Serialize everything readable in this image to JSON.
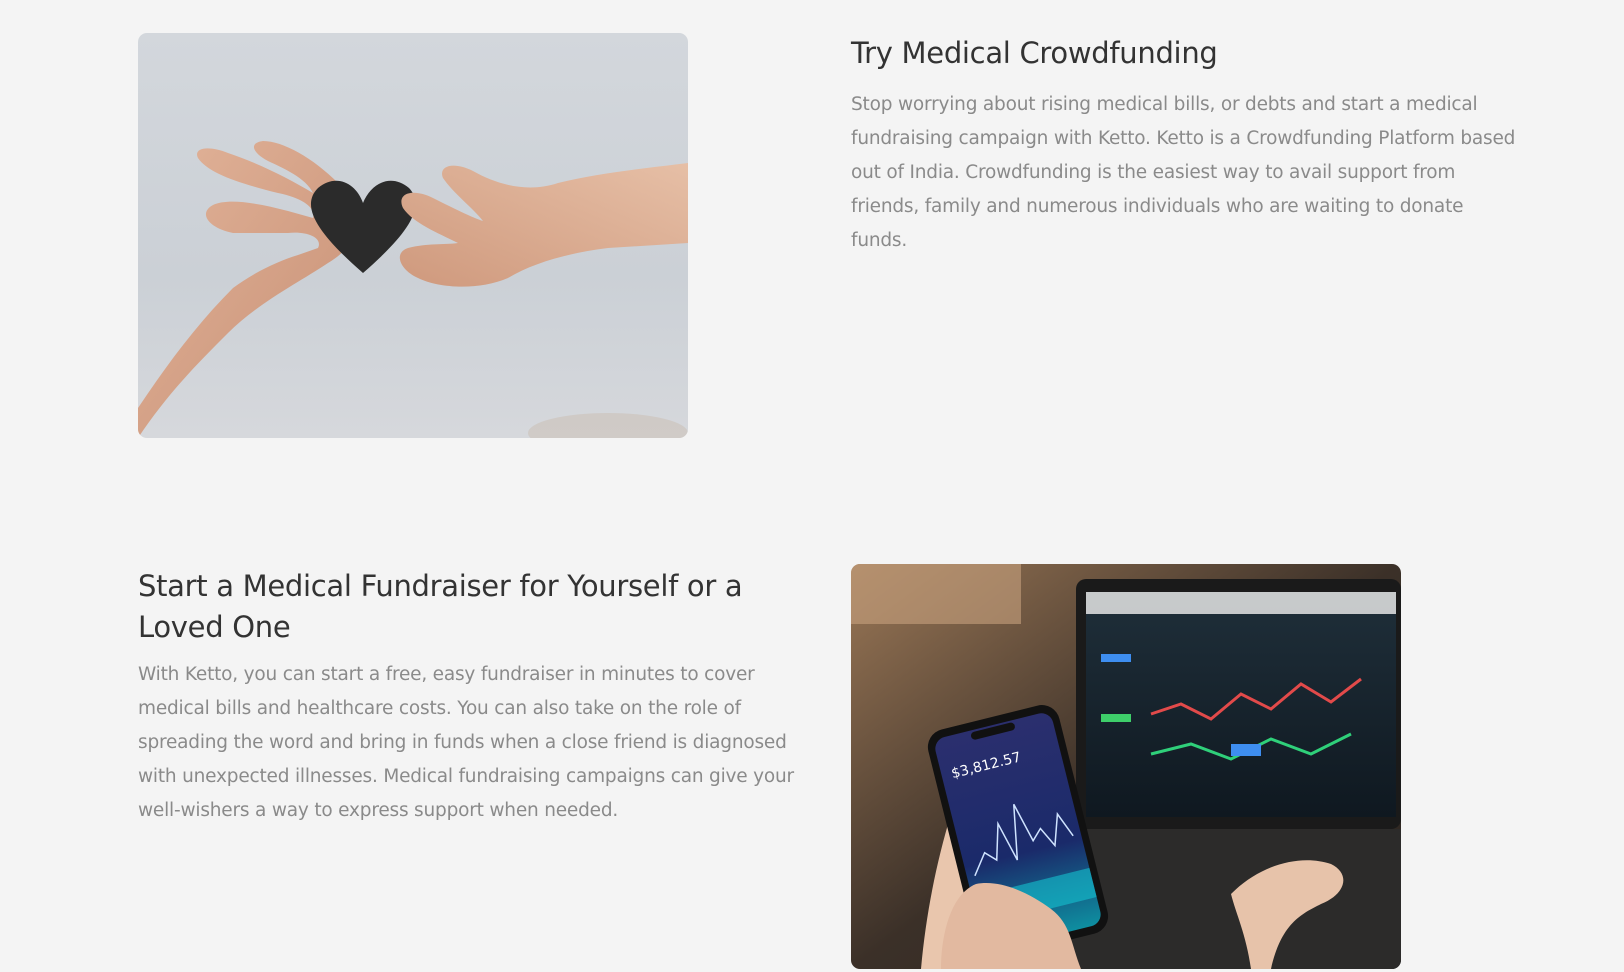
{
  "sections": [
    {
      "title": "Try Medical Crowdfunding",
      "body": "Stop worrying about rising medical bills, or debts and start a medical fundraising campaign with Ketto. Ketto is a Crowdfunding Platform based out of India. Crowdfunding is the easiest way to avail support from friends, family and numerous individuals who are waiting to donate funds.",
      "image": "hands-holding-heart-image"
    },
    {
      "title": "Start a Medical Fundraiser for Yourself or a Loved One",
      "body": "With Ketto, you can start a free, easy fundraiser in minutes to cover medical bills and healthcare costs. You can also take on the role of spreading the word and bring in funds when a close friend is diagnosed with unexpected illnesses. Medical fundraising campaigns can give your well-wishers a way to express support when needed.",
      "image": "phone-and-laptop-image",
      "phone_screen_value": "$3,812.57"
    }
  ],
  "colors": {
    "background": "#f4f4f4",
    "heading": "#333333",
    "body": "#8a8a8a"
  }
}
